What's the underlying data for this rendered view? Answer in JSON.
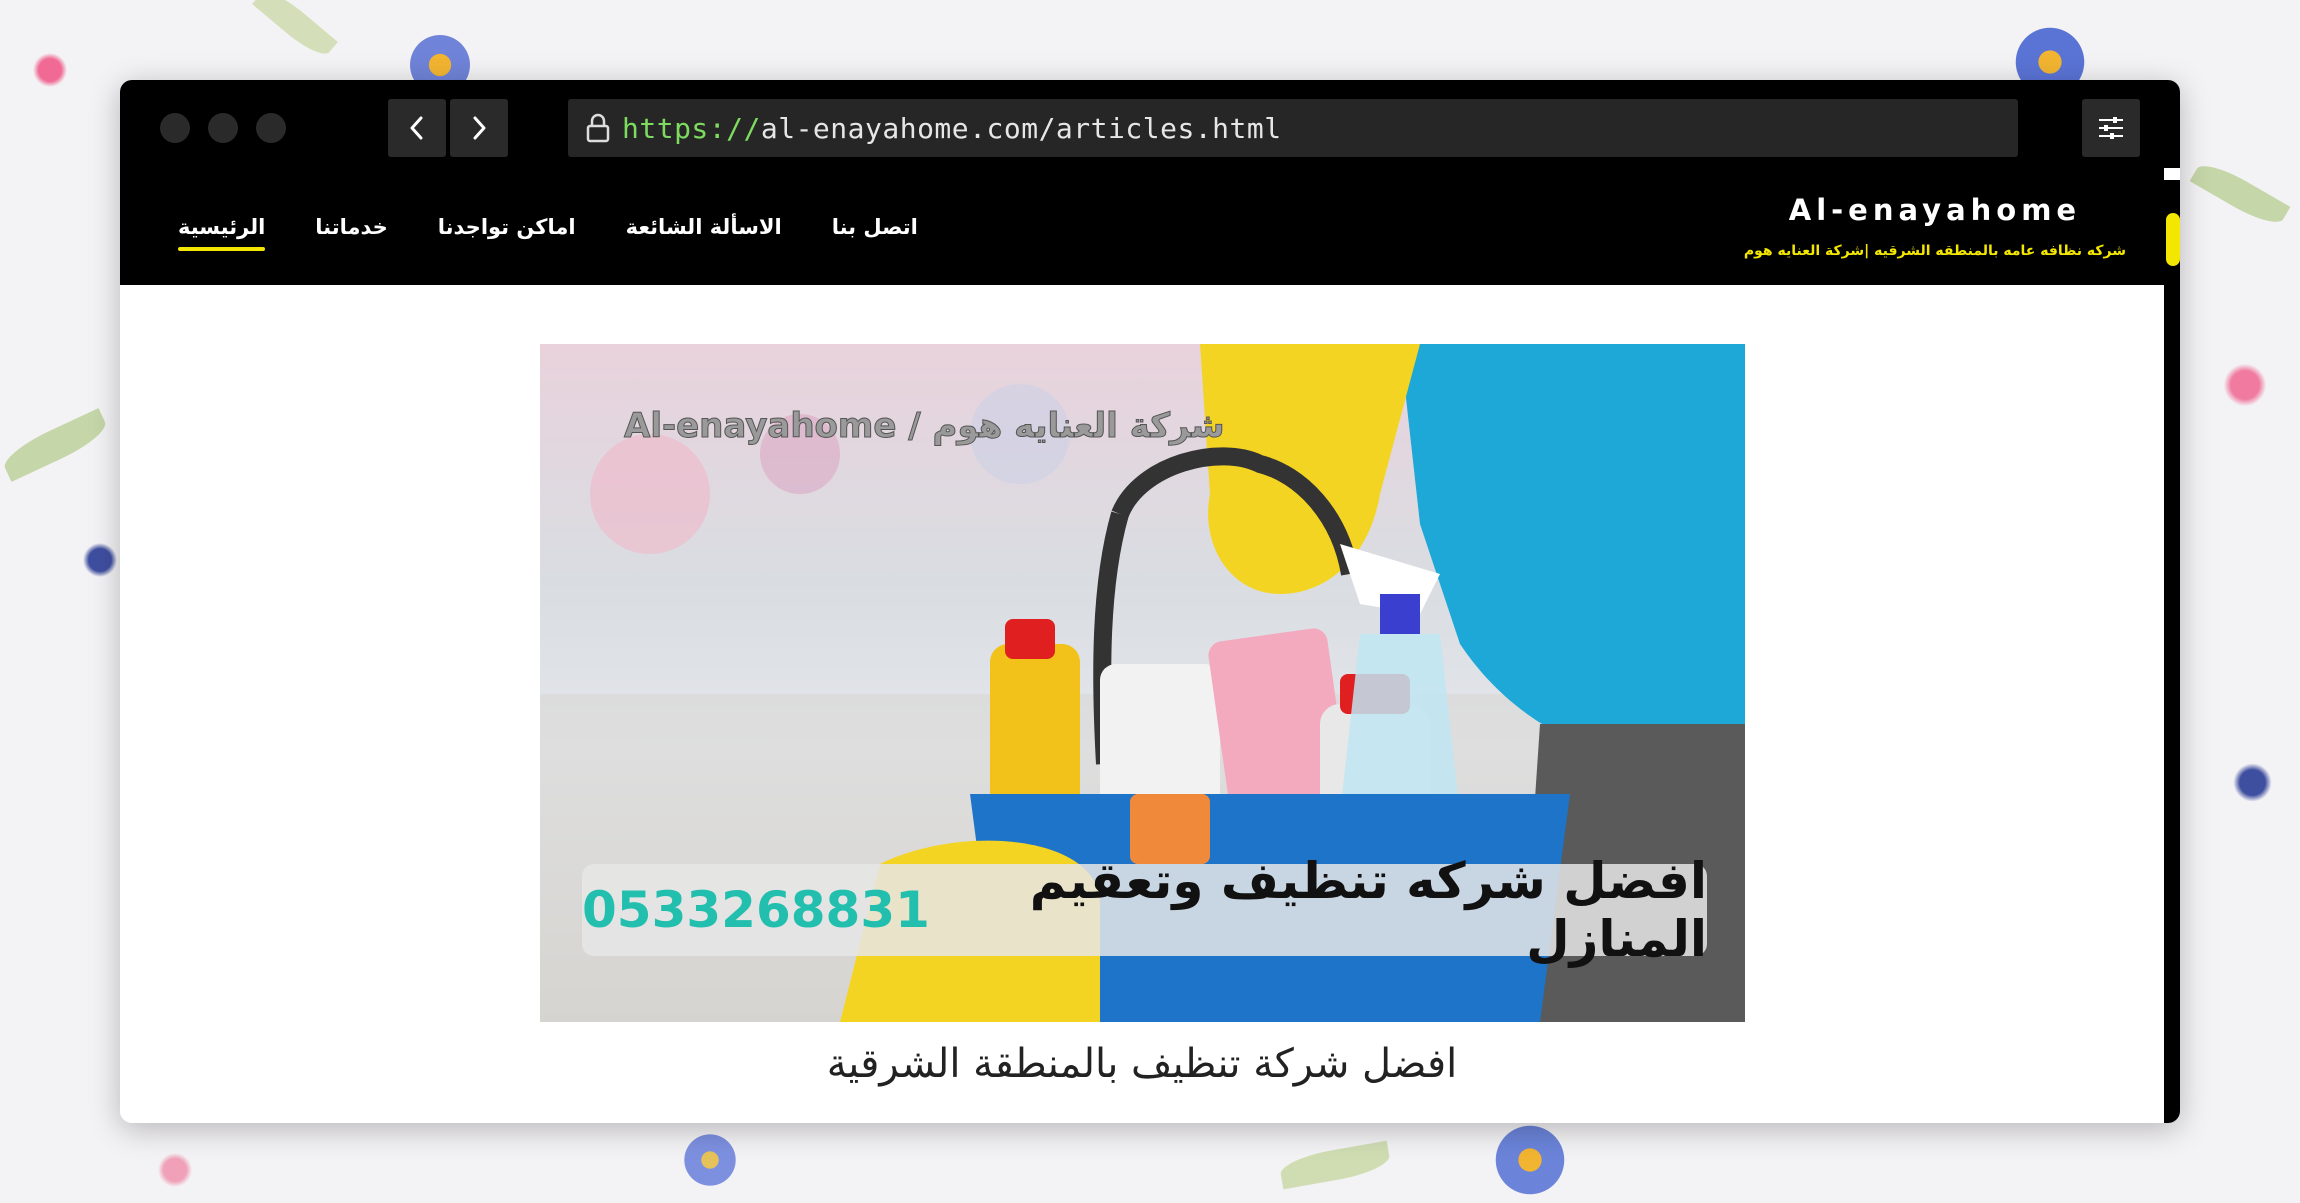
{
  "browser": {
    "url_scheme": "https://",
    "url_rest": "al-enayahome.com/articles.html"
  },
  "site": {
    "brand_title": "Al-enayahome",
    "brand_subtitle": "شركه نظافه عامه بالمنطقه الشرقيه |شركة العنايه هوم",
    "nav": [
      {
        "label": "الرئيسية",
        "active": true
      },
      {
        "label": "خدماتنا",
        "active": false
      },
      {
        "label": "اماكن تواجدنا",
        "active": false
      },
      {
        "label": "الاسألة الشائعة",
        "active": false
      },
      {
        "label": "اتصل بنا",
        "active": false
      }
    ]
  },
  "hero": {
    "watermark": "Al-enayahome / شركة العنايه هوم",
    "banner_text": "افضل شركه تنظيف وتعقيم المنازل",
    "banner_phone": "0533268831"
  },
  "article": {
    "title": "افضل شركة تنظيف بالمنطقة الشرقية"
  },
  "colors": {
    "accent_yellow": "#f3e600",
    "phone_teal": "#22bfae",
    "chrome_black": "#000000"
  }
}
